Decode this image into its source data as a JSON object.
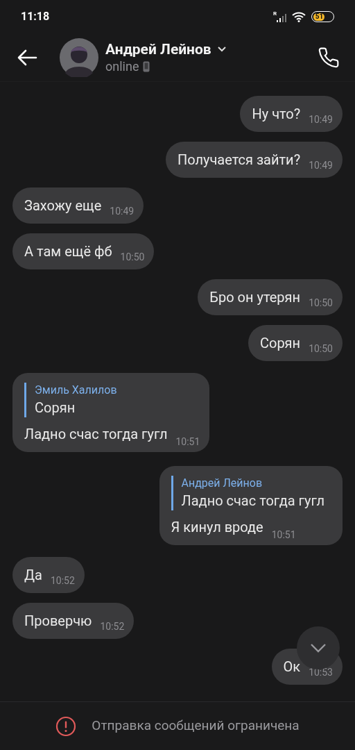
{
  "status_bar": {
    "time": "11:18",
    "battery": "51",
    "network_mark": "R"
  },
  "header": {
    "name": "Андрей Лейнов",
    "status": "online"
  },
  "messages": [
    {
      "kind": "plain",
      "outgoing": true,
      "text": "Ну что?",
      "time": "10:49"
    },
    {
      "kind": "plain",
      "outgoing": true,
      "text": "Получается зайти?",
      "time": "10:49"
    },
    {
      "kind": "plain",
      "outgoing": false,
      "text": "Захожу еще",
      "time": "10:49"
    },
    {
      "kind": "plain",
      "outgoing": false,
      "text": "А там ещё фб",
      "time": "10:50"
    },
    {
      "kind": "plain",
      "outgoing": true,
      "text": "Бро он утерян",
      "time": "10:50"
    },
    {
      "kind": "plain",
      "outgoing": true,
      "text": "Сорян",
      "time": "10:50"
    },
    {
      "kind": "reply",
      "outgoing": false,
      "reply_author": "Эмиль Халилов",
      "reply_text": "Сорян",
      "text": "Ладно счас тогда гугл",
      "time": "10:51"
    },
    {
      "kind": "reply",
      "outgoing": true,
      "reply_author": "Андрей Лейнов",
      "reply_text": "Ладно счас тогда гугл",
      "text": "Я кинул вроде",
      "time": "10:51"
    },
    {
      "kind": "plain",
      "outgoing": false,
      "text": "Да",
      "time": "10:52"
    },
    {
      "kind": "plain",
      "outgoing": false,
      "text": "Проверчю",
      "time": "10:52"
    },
    {
      "kind": "plain",
      "outgoing": true,
      "text": "Ок",
      "time": "10:53"
    }
  ],
  "notice": "Отправка сообщений ограничена"
}
